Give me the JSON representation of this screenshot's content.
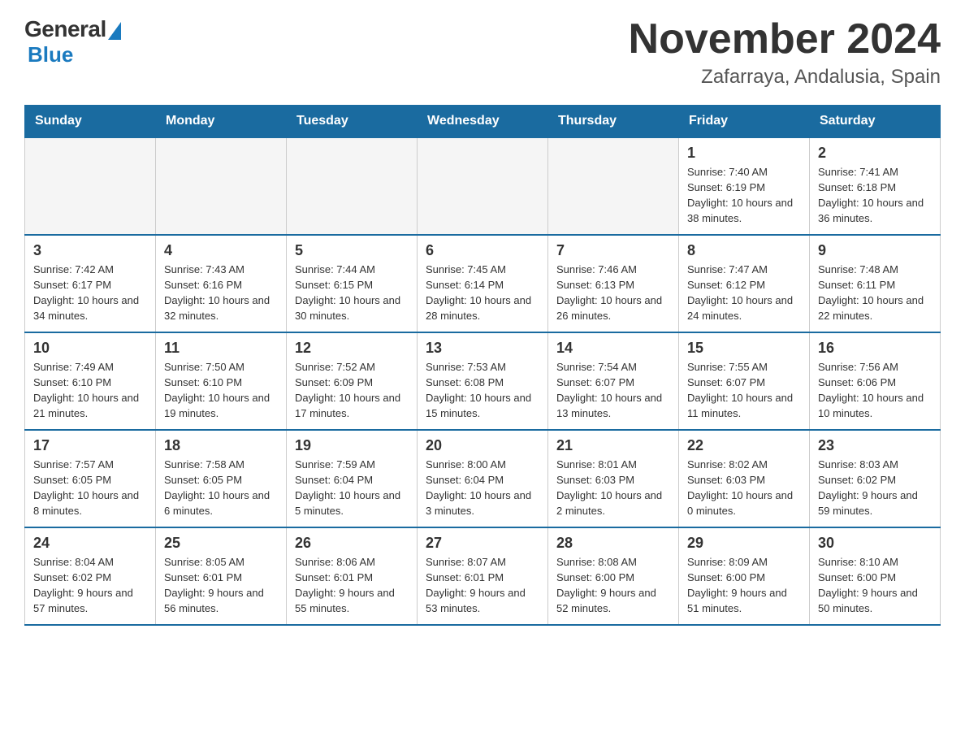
{
  "header": {
    "logo": {
      "general": "General",
      "blue": "Blue"
    },
    "title": "November 2024",
    "subtitle": "Zafarraya, Andalusia, Spain"
  },
  "calendar": {
    "days_of_week": [
      "Sunday",
      "Monday",
      "Tuesday",
      "Wednesday",
      "Thursday",
      "Friday",
      "Saturday"
    ],
    "weeks": [
      [
        {
          "day": "",
          "info": "",
          "empty": true
        },
        {
          "day": "",
          "info": "",
          "empty": true
        },
        {
          "day": "",
          "info": "",
          "empty": true
        },
        {
          "day": "",
          "info": "",
          "empty": true
        },
        {
          "day": "",
          "info": "",
          "empty": true
        },
        {
          "day": "1",
          "info": "Sunrise: 7:40 AM\nSunset: 6:19 PM\nDaylight: 10 hours and 38 minutes."
        },
        {
          "day": "2",
          "info": "Sunrise: 7:41 AM\nSunset: 6:18 PM\nDaylight: 10 hours and 36 minutes."
        }
      ],
      [
        {
          "day": "3",
          "info": "Sunrise: 7:42 AM\nSunset: 6:17 PM\nDaylight: 10 hours and 34 minutes."
        },
        {
          "day": "4",
          "info": "Sunrise: 7:43 AM\nSunset: 6:16 PM\nDaylight: 10 hours and 32 minutes."
        },
        {
          "day": "5",
          "info": "Sunrise: 7:44 AM\nSunset: 6:15 PM\nDaylight: 10 hours and 30 minutes."
        },
        {
          "day": "6",
          "info": "Sunrise: 7:45 AM\nSunset: 6:14 PM\nDaylight: 10 hours and 28 minutes."
        },
        {
          "day": "7",
          "info": "Sunrise: 7:46 AM\nSunset: 6:13 PM\nDaylight: 10 hours and 26 minutes."
        },
        {
          "day": "8",
          "info": "Sunrise: 7:47 AM\nSunset: 6:12 PM\nDaylight: 10 hours and 24 minutes."
        },
        {
          "day": "9",
          "info": "Sunrise: 7:48 AM\nSunset: 6:11 PM\nDaylight: 10 hours and 22 minutes."
        }
      ],
      [
        {
          "day": "10",
          "info": "Sunrise: 7:49 AM\nSunset: 6:10 PM\nDaylight: 10 hours and 21 minutes."
        },
        {
          "day": "11",
          "info": "Sunrise: 7:50 AM\nSunset: 6:10 PM\nDaylight: 10 hours and 19 minutes."
        },
        {
          "day": "12",
          "info": "Sunrise: 7:52 AM\nSunset: 6:09 PM\nDaylight: 10 hours and 17 minutes."
        },
        {
          "day": "13",
          "info": "Sunrise: 7:53 AM\nSunset: 6:08 PM\nDaylight: 10 hours and 15 minutes."
        },
        {
          "day": "14",
          "info": "Sunrise: 7:54 AM\nSunset: 6:07 PM\nDaylight: 10 hours and 13 minutes."
        },
        {
          "day": "15",
          "info": "Sunrise: 7:55 AM\nSunset: 6:07 PM\nDaylight: 10 hours and 11 minutes."
        },
        {
          "day": "16",
          "info": "Sunrise: 7:56 AM\nSunset: 6:06 PM\nDaylight: 10 hours and 10 minutes."
        }
      ],
      [
        {
          "day": "17",
          "info": "Sunrise: 7:57 AM\nSunset: 6:05 PM\nDaylight: 10 hours and 8 minutes."
        },
        {
          "day": "18",
          "info": "Sunrise: 7:58 AM\nSunset: 6:05 PM\nDaylight: 10 hours and 6 minutes."
        },
        {
          "day": "19",
          "info": "Sunrise: 7:59 AM\nSunset: 6:04 PM\nDaylight: 10 hours and 5 minutes."
        },
        {
          "day": "20",
          "info": "Sunrise: 8:00 AM\nSunset: 6:04 PM\nDaylight: 10 hours and 3 minutes."
        },
        {
          "day": "21",
          "info": "Sunrise: 8:01 AM\nSunset: 6:03 PM\nDaylight: 10 hours and 2 minutes."
        },
        {
          "day": "22",
          "info": "Sunrise: 8:02 AM\nSunset: 6:03 PM\nDaylight: 10 hours and 0 minutes."
        },
        {
          "day": "23",
          "info": "Sunrise: 8:03 AM\nSunset: 6:02 PM\nDaylight: 9 hours and 59 minutes."
        }
      ],
      [
        {
          "day": "24",
          "info": "Sunrise: 8:04 AM\nSunset: 6:02 PM\nDaylight: 9 hours and 57 minutes."
        },
        {
          "day": "25",
          "info": "Sunrise: 8:05 AM\nSunset: 6:01 PM\nDaylight: 9 hours and 56 minutes."
        },
        {
          "day": "26",
          "info": "Sunrise: 8:06 AM\nSunset: 6:01 PM\nDaylight: 9 hours and 55 minutes."
        },
        {
          "day": "27",
          "info": "Sunrise: 8:07 AM\nSunset: 6:01 PM\nDaylight: 9 hours and 53 minutes."
        },
        {
          "day": "28",
          "info": "Sunrise: 8:08 AM\nSunset: 6:00 PM\nDaylight: 9 hours and 52 minutes."
        },
        {
          "day": "29",
          "info": "Sunrise: 8:09 AM\nSunset: 6:00 PM\nDaylight: 9 hours and 51 minutes."
        },
        {
          "day": "30",
          "info": "Sunrise: 8:10 AM\nSunset: 6:00 PM\nDaylight: 9 hours and 50 minutes."
        }
      ]
    ]
  }
}
